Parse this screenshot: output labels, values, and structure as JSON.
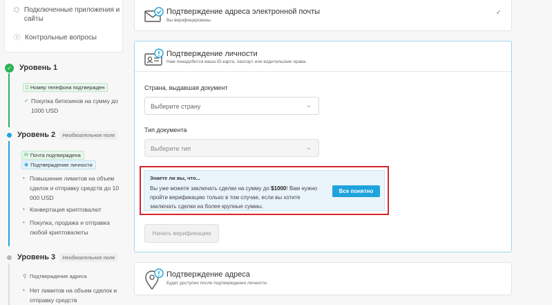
{
  "sidebar": {
    "menu": {
      "apps_label": "Подключенные приложения и сайты",
      "questions_label": "Контрольные вопросы"
    },
    "level1": {
      "title": "Уровень 1",
      "badges": [
        "Номер телефона подтвержден"
      ],
      "features": [
        "Покупка биткоинов на сумму до 1000 USD"
      ]
    },
    "level2": {
      "title": "Уровень 2",
      "optional": "Необязательное поле",
      "badges": [
        "Почта подтверждена",
        "Подтверждение личности"
      ],
      "features": [
        "Повышение лимитов на объем сделок и отправку средств до 10 000 USD",
        "Конвертация криптовалют",
        "Покупка, продажа и отправка любой криптовалюты"
      ]
    },
    "level3": {
      "title": "Уровень 3",
      "optional": "Необязательное поле",
      "badges": [
        "Подтверждение адреса"
      ],
      "features": [
        "Нет лимитов на объем сделок и отправку средств"
      ]
    }
  },
  "email_card": {
    "title": "Подтверждение адреса электронной почты",
    "subtitle": "Вы верифицированы"
  },
  "identity_card": {
    "title": "Подтверждение личности",
    "subtitle": "Нам понадобится ваша ID-карта, паспорт или водительские права.",
    "country_label": "Страна, выдавшая документ",
    "country_placeholder": "Выберите страну",
    "doc_type_label": "Тип документа",
    "doc_type_placeholder": "Выберите тип",
    "info": {
      "title": "Знаете ли вы, что...",
      "text_before": "Вы уже можете заключать сделки на сумму до ",
      "amount": "$1000",
      "text_after": "! Вам нужно пройти верификацию только в том случае, если вы хотите заключать сделки на более крупные суммы.",
      "button": "Все понятно"
    },
    "start_button": "Начать верификацию"
  },
  "address_card": {
    "title": "Подтверждение адреса",
    "subtitle": "Будет доступно после подтверждения личности."
  },
  "colors": {
    "accent": "#1fa3dc",
    "success": "#2eb358",
    "highlight": "#d7242b"
  }
}
